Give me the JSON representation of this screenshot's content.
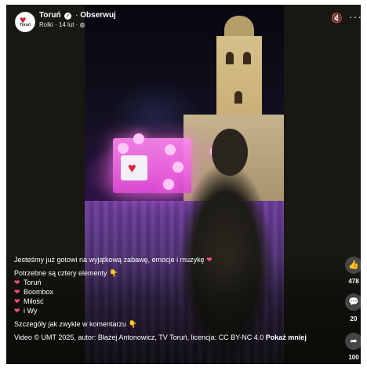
{
  "header": {
    "page_name": "Toruń",
    "verified_glyph": "✓",
    "separator": " · ",
    "follow_label": "Obserwuj",
    "meta": "Rolki · 14 lut · ",
    "globe_glyph": "◍",
    "avatar_label": "Toruń",
    "avatar_icon": "heart-logo-icon"
  },
  "controls": {
    "mute_glyph": "🔇",
    "more_glyph": "···"
  },
  "caption": {
    "line1": "Jesteśmy już gotowi na wyjątkową zabawę, emocje i muzykę ",
    "line1_emoji": "❤",
    "line2": "Potrzebne są cztery elementy ",
    "line2_emoji": "👇",
    "items": [
      {
        "bullet": "❤",
        "text": "Toruń"
      },
      {
        "bullet": "❤",
        "text": "Boombox"
      },
      {
        "bullet": "❤",
        "text": "Miłość"
      },
      {
        "bullet": "❤",
        "text": "i Wy"
      }
    ],
    "details": "Szczegóły jak zwykle w komentarzu ",
    "details_emoji": "👇",
    "credit": "Video © UMT 2025, autor: Błażej Antonowicz, TV Toruń, licencja: CC BY-NC 4.0 ",
    "more_link": "Pokaż mniej"
  },
  "actions": {
    "like": {
      "icon": "👍",
      "count": "478"
    },
    "comment": {
      "icon": "💬",
      "count": "20"
    },
    "share": {
      "icon": "➦",
      "count": "100"
    }
  },
  "colors": {
    "background": "#181712",
    "accent_heart": "#ff4b7a",
    "action_button": "#505050"
  }
}
